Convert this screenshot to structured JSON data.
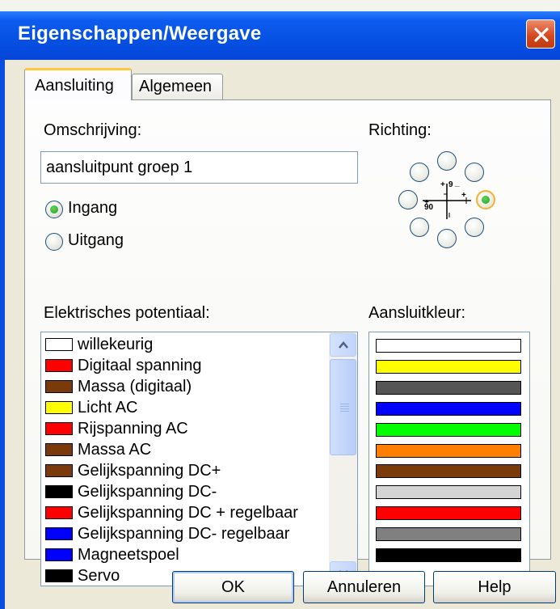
{
  "dialog": {
    "title": "Eigenschappen/Weergave",
    "tabs": [
      {
        "label": "Aansluiting",
        "active": true
      },
      {
        "label": "Algemeen",
        "active": false
      }
    ]
  },
  "form": {
    "description_label": "Omschrijving:",
    "description_value": "aansluitpunt groep 1",
    "direction_label": "Richting:",
    "direction_selected": "right",
    "radios": [
      {
        "label": "Ingang",
        "checked": true
      },
      {
        "label": "Uitgang",
        "checked": false
      }
    ],
    "potential_label": "Elektrisches potentiaal:",
    "color_label": "Aansluitkleur:"
  },
  "potential_list": [
    {
      "label": "willekeurig",
      "color": "#ffffff"
    },
    {
      "label": "Digitaal spanning",
      "color": "#ff0000"
    },
    {
      "label": "Massa (digitaal)",
      "color": "#7a3a0c"
    },
    {
      "label": "Licht AC",
      "color": "#ffff00"
    },
    {
      "label": "Rijspanning AC",
      "color": "#ff0000"
    },
    {
      "label": "Massa AC",
      "color": "#7a3a0c"
    },
    {
      "label": "Gelijkspanning DC+",
      "color": "#7a3a0c"
    },
    {
      "label": "Gelijkspanning DC-",
      "color": "#000000"
    },
    {
      "label": "Gelijkspanning DC + regelbaar",
      "color": "#ff0000"
    },
    {
      "label": "Gelijkspanning DC- regelbaar",
      "color": "#0000ff"
    },
    {
      "label": "Magneetspoel",
      "color": "#0000ff"
    },
    {
      "label": "Servo",
      "color": "#000000"
    }
  ],
  "connection_colors": [
    "#ffffff",
    "#ffff00",
    "#555555",
    "#0000ff",
    "#00ff00",
    "#ff7f00",
    "#7a3a0c",
    "#d4d4d4",
    "#ff0000",
    "#808080",
    "#000000"
  ],
  "direction_diagram": {
    "labels": [
      "+",
      "9",
      "_",
      "+",
      "90",
      "+"
    ]
  },
  "buttons": {
    "ok": "OK",
    "cancel": "Annuleren",
    "help": "Help"
  }
}
